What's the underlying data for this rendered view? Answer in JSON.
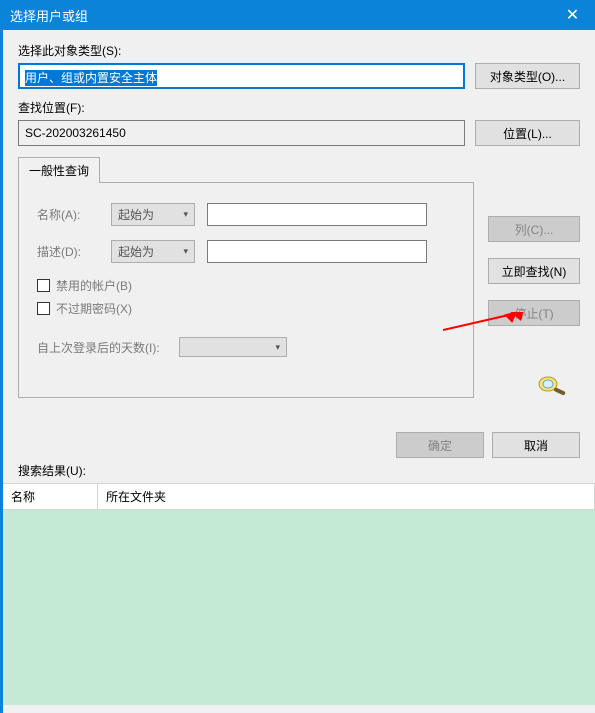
{
  "titlebar": {
    "title": "选择用户或组"
  },
  "section1": {
    "object_type_label": "选择此对象类型(S):",
    "object_type_value": "用户、组或内置安全主体",
    "object_type_button": "对象类型(O)...",
    "location_label": "查找位置(F):",
    "location_value": "SC-202003261450",
    "location_button": "位置(L)..."
  },
  "tabs": {
    "general": "一般性查询"
  },
  "query": {
    "name_label": "名称(A):",
    "desc_label": "描述(D):",
    "starts_with": "起始为",
    "disabled_accounts": "禁用的帐户(B)",
    "no_expire_pwd": "不过期密码(X)",
    "days_since_login": "自上次登录后的天数(I):"
  },
  "side": {
    "columns": "列(C)...",
    "search_now": "立即查找(N)",
    "stop": "停止(T)"
  },
  "bottom": {
    "ok": "确定",
    "cancel": "取消"
  },
  "results": {
    "label": "搜索结果(U):",
    "col_name": "名称",
    "col_folder": "所在文件夹"
  }
}
